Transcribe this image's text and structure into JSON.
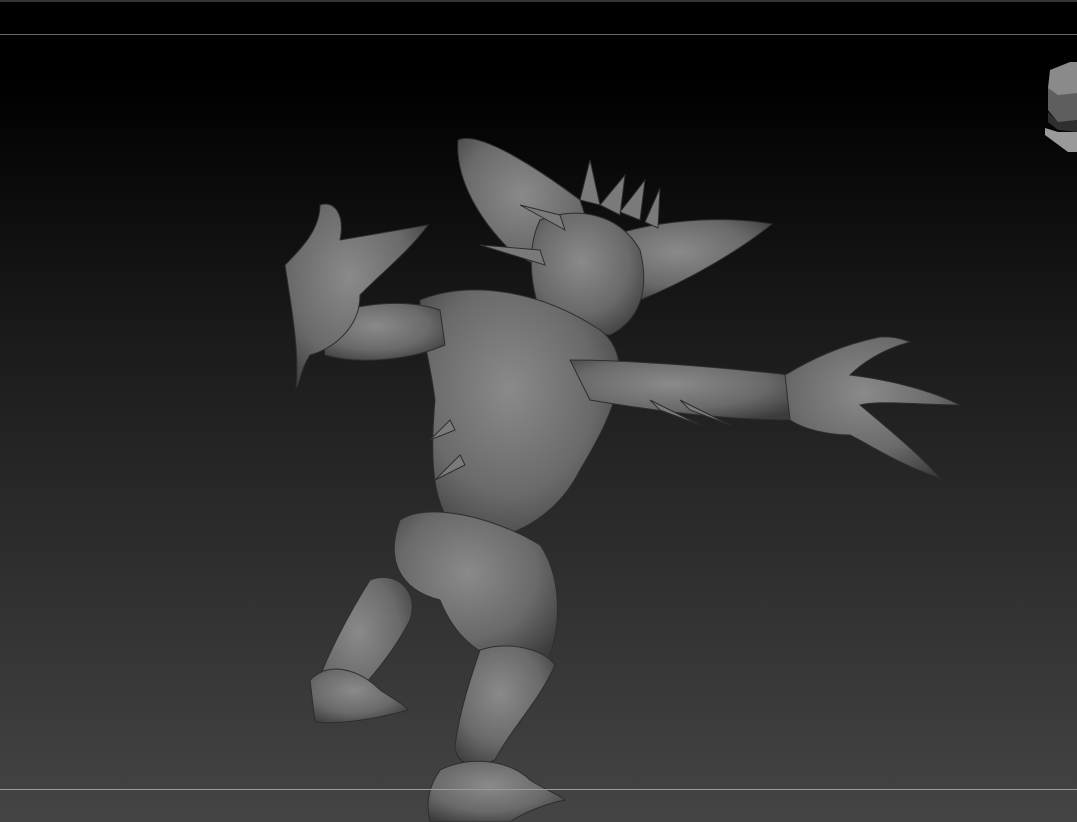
{
  "viewport": {
    "background_top": "#000000",
    "background_bottom": "#444444",
    "model_color": "#6e6e6e",
    "model_shadow": "#3a3a3a",
    "model_highlight": "#8c8c8c"
  },
  "icons": {
    "nav_cube": "navigation-cube-icon"
  }
}
